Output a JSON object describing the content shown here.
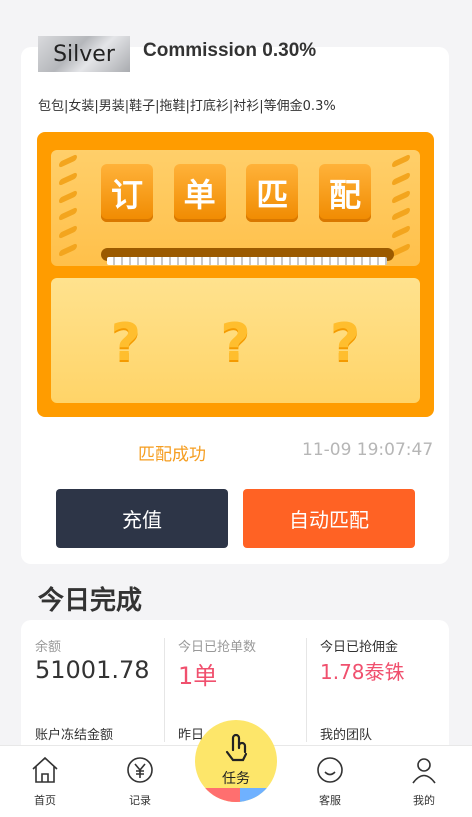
{
  "header": {
    "level": "Silver",
    "commission": "Commission 0.30%",
    "categories": "包包|女装|男装|鞋子|拖鞋|打底衫|衬衫|等佣金0.3%"
  },
  "machine": {
    "tiles": [
      "订",
      "单",
      "匹",
      "配"
    ],
    "placeholders": [
      "?",
      "?",
      "?"
    ]
  },
  "match": {
    "status": "匹配成功",
    "time": "11-09 19:07:47"
  },
  "buttons": {
    "recharge": "充值",
    "auto_match": "自动匹配"
  },
  "today": {
    "title": "今日完成",
    "balance_label": "余额",
    "balance_value": "51001.78",
    "orders_label": "今日已抢单数",
    "orders_value": "1单",
    "commission_label": "今日已抢佣金",
    "commission_value": "1.78泰铢",
    "frozen_label": "账户冻结金额",
    "yesterday_label": "昨日",
    "team_label": "我的团队"
  },
  "tabbar": {
    "home": "首页",
    "records": "记录",
    "task": "任务",
    "service": "客服",
    "mine": "我的"
  },
  "colors": {
    "accent_orange": "#ff6224",
    "dark_button": "#2d3547",
    "success_text": "#f59d1f",
    "red_value": "#f0506e"
  }
}
